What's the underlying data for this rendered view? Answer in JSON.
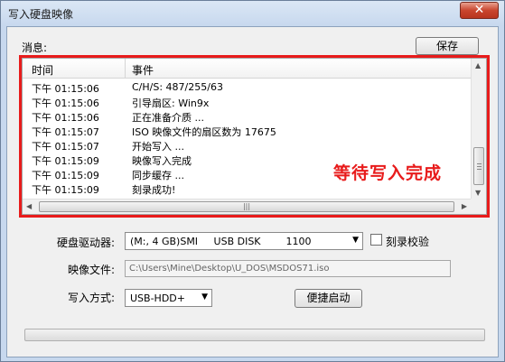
{
  "window": {
    "title": "写入硬盘映像",
    "close_label": "✕"
  },
  "message": {
    "label": "消息:",
    "save_label": "保存"
  },
  "log": {
    "headers": {
      "time": "时间",
      "event": "事件"
    },
    "rows": [
      {
        "time": "下午 01:15:06",
        "event": "C/H/S: 487/255/63"
      },
      {
        "time": "下午 01:15:06",
        "event": "引导扇区: Win9x"
      },
      {
        "time": "下午 01:15:06",
        "event": "正在准备介质 ..."
      },
      {
        "time": "下午 01:15:07",
        "event": "ISO 映像文件的扇区数为 17675"
      },
      {
        "time": "下午 01:15:07",
        "event": "开始写入 ..."
      },
      {
        "time": "下午 01:15:09",
        "event": "映像写入完成"
      },
      {
        "time": "下午 01:15:09",
        "event": "同步缓存 ..."
      },
      {
        "time": "下午 01:15:09",
        "event": "刻录成功!"
      }
    ],
    "annotation": "等待写入完成"
  },
  "form": {
    "drive_label": "硬盘驱动器:",
    "drive_value": "(M:, 4 GB)SMI     USB DISK        1100",
    "verify_label": "刻录校验",
    "image_label": "映像文件:",
    "image_value": "C:\\Users\\Mine\\Desktop\\U_DOS\\MSDOS71.iso",
    "method_label": "写入方式:",
    "method_value": "USB-HDD+",
    "boot_label": "便捷启动"
  },
  "progress": {
    "value": 0
  },
  "colors": {
    "annotation": "#e81b1b",
    "frame": "#e81b1b"
  }
}
